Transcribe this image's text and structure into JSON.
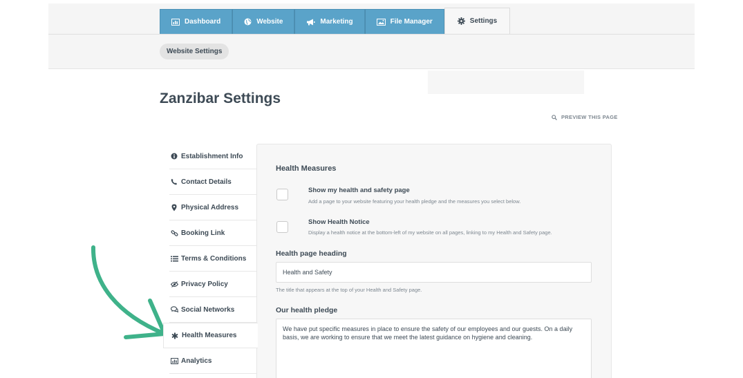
{
  "tabs": [
    {
      "label": "Dashboard",
      "icon": "bar-chart-icon"
    },
    {
      "label": "Website",
      "icon": "globe-icon"
    },
    {
      "label": "Marketing",
      "icon": "megaphone-icon"
    },
    {
      "label": "File Manager",
      "icon": "image-icon"
    },
    {
      "label": "Settings",
      "icon": "gear-icon",
      "active": true
    }
  ],
  "subnav": {
    "label": "Website Settings"
  },
  "page": {
    "title": "Zanzibar Settings",
    "preview_label": "PREVIEW THIS PAGE"
  },
  "sidebar": {
    "items": [
      {
        "label": "Establishment Info",
        "icon": "info-icon"
      },
      {
        "label": "Contact Details",
        "icon": "phone-icon"
      },
      {
        "label": "Physical Address",
        "icon": "map-pin-icon"
      },
      {
        "label": "Booking Link",
        "icon": "link-icon"
      },
      {
        "label": "Terms & Conditions",
        "icon": "list-icon"
      },
      {
        "label": "Privacy Policy",
        "icon": "eye-slash-icon"
      },
      {
        "label": "Social Networks",
        "icon": "chat-icon"
      },
      {
        "label": "Health Measures",
        "icon": "asterisk-icon",
        "active": true
      },
      {
        "label": "Analytics",
        "icon": "bar-chart-icon"
      }
    ]
  },
  "health": {
    "section_title": "Health Measures",
    "option1": {
      "label": "Show my health and safety page",
      "desc": "Add a page to your website featuring your health pledge and the measures you select below.",
      "checked": false
    },
    "option2": {
      "label": "Show Health Notice",
      "desc": "Display a health notice at the bottom-left of my website on all pages, linking to my Health and Safety page.",
      "checked": false
    },
    "heading_label": "Health page heading",
    "heading_value": "Health and Safety",
    "heading_help": "The title that appears at the top of your Health and Safety page.",
    "pledge_label": "Our health pledge",
    "pledge_value": "We have put specific measures in place to ensure the safety of our employees and our guests. On a daily basis, we are working to ensure that we meet the latest guidance on hygiene and cleaning."
  },
  "colors": {
    "tab_blue": "#5aa3c9",
    "arrow_green": "#3fb28a",
    "text_dark": "#3d4a55"
  }
}
